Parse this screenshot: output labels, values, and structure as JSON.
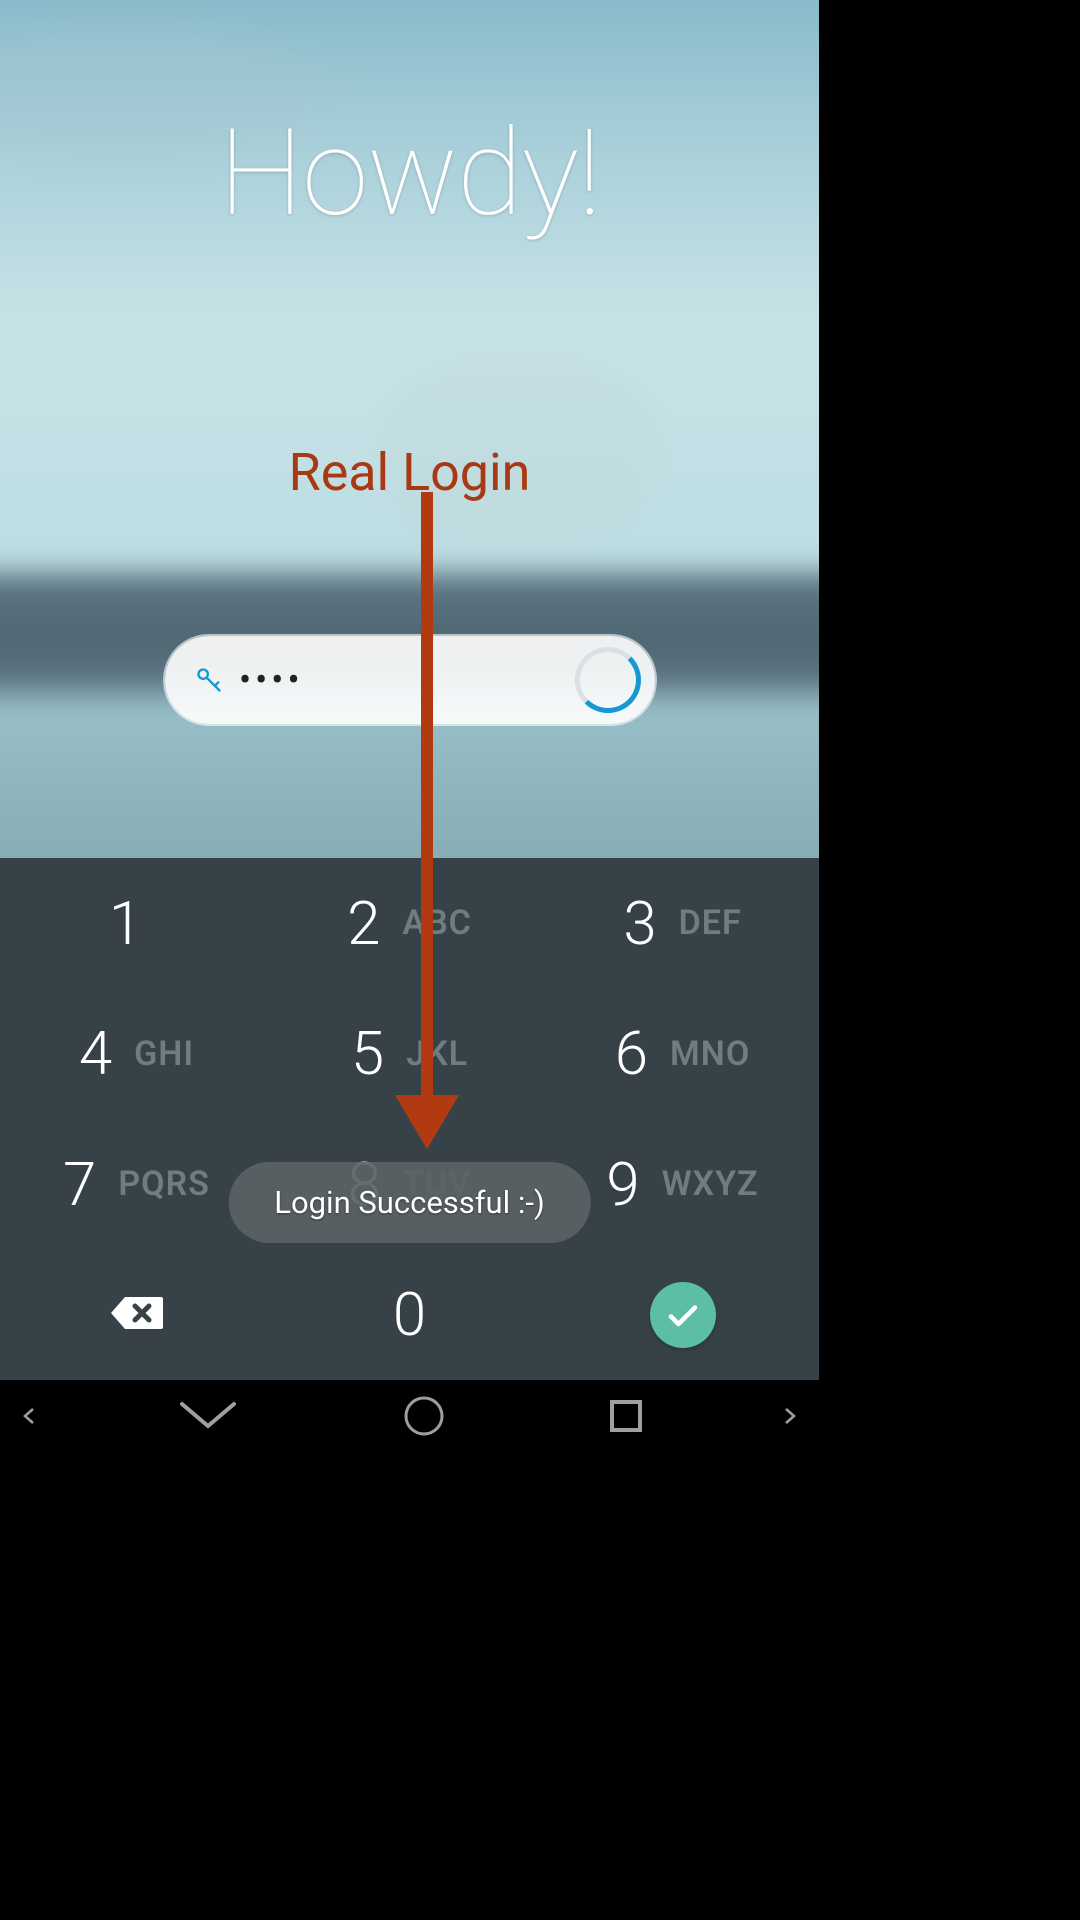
{
  "greeting": "Howdy!",
  "login_label": "Real Login",
  "pin_mask": "••••",
  "toast": "Login Successful :-)",
  "keypad": {
    "keys": [
      {
        "digit": "1",
        "letters": ""
      },
      {
        "digit": "2",
        "letters": "ABC"
      },
      {
        "digit": "3",
        "letters": "DEF"
      },
      {
        "digit": "4",
        "letters": "GHI"
      },
      {
        "digit": "5",
        "letters": "JKL"
      },
      {
        "digit": "6",
        "letters": "MNO"
      },
      {
        "digit": "7",
        "letters": "PQRS"
      },
      {
        "digit": "8",
        "letters": "TUV"
      },
      {
        "digit": "9",
        "letters": "WXYZ"
      }
    ],
    "zero": "0"
  },
  "icons": {
    "key": "key-icon",
    "backspace": "backspace-icon",
    "confirm": "checkmark-icon"
  },
  "colors": {
    "accent": "#b23a11",
    "spinner": "#1797d3",
    "keypad_bg": "#374248",
    "ok_button": "#5cbfa5"
  }
}
